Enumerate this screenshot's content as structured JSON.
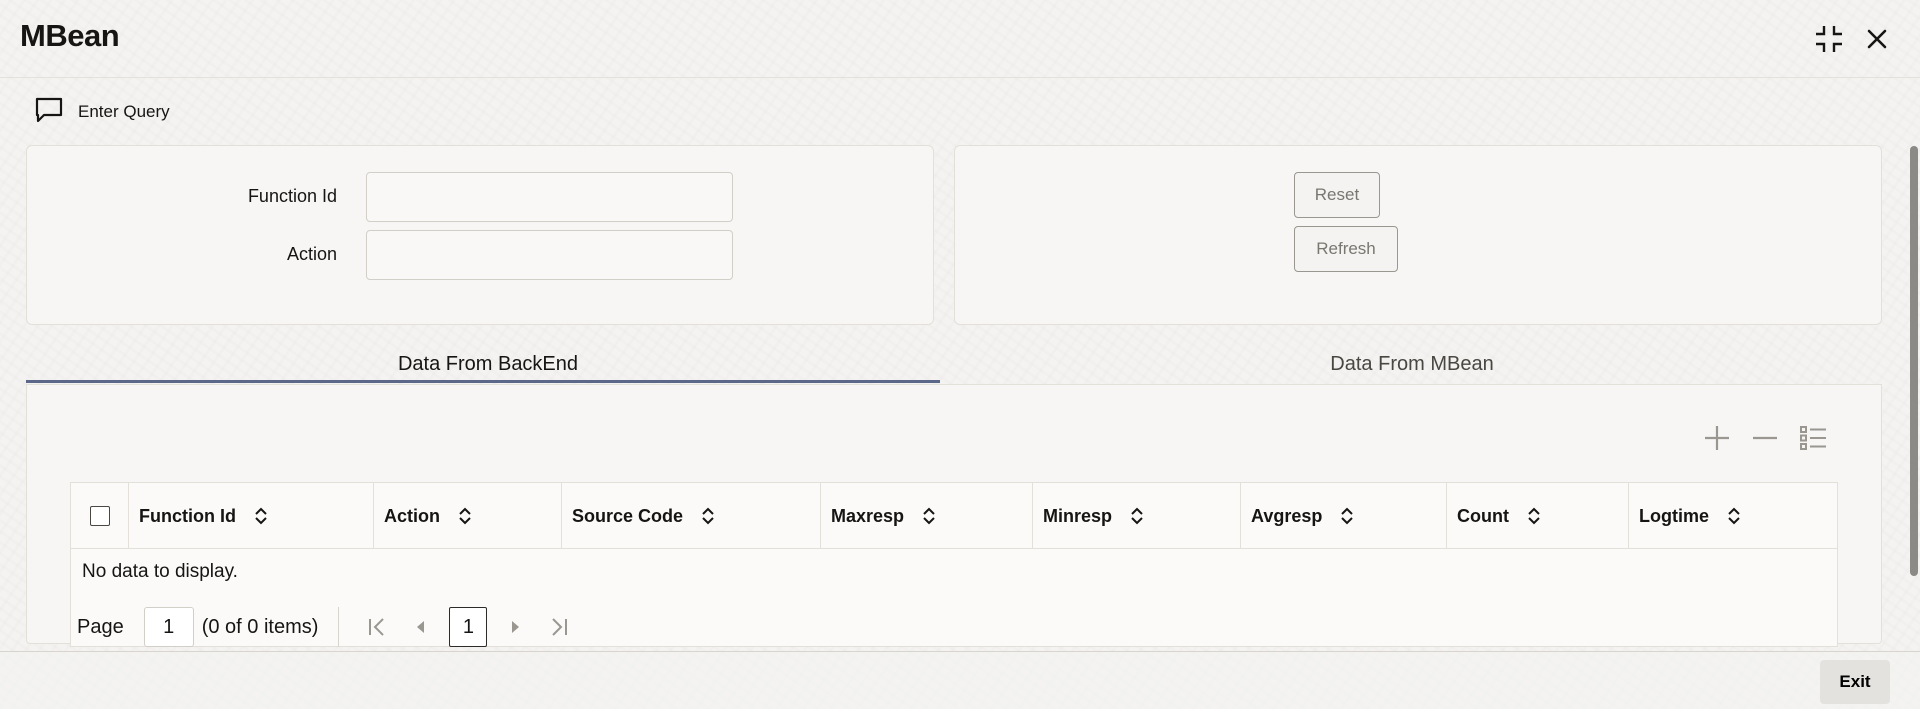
{
  "window": {
    "title": "MBean",
    "controls": {
      "collapse_icon": "collapse-icon",
      "close_icon": "close-icon"
    }
  },
  "toolbar": {
    "enter_query_label": "Enter Query",
    "enter_query_icon": "chat-bubble-icon"
  },
  "form": {
    "function_id_label": "Function Id",
    "function_id_value": "",
    "action_label": "Action",
    "action_value": ""
  },
  "buttons": {
    "reset_label": "Reset",
    "refresh_label": "Refresh"
  },
  "tabs": [
    {
      "label": "Data From BackEnd",
      "active": true
    },
    {
      "label": "Data From MBean",
      "active": false
    }
  ],
  "grid": {
    "tools": [
      "add-icon",
      "remove-icon",
      "list-view-icon"
    ],
    "columns": [
      "Function Id",
      "Action",
      "Source Code",
      "Maxresp",
      "Minresp",
      "Avgresp",
      "Count",
      "Logtime"
    ],
    "empty_message": "No data to display.",
    "pager": {
      "page_label": "Page",
      "page_value": "1",
      "items_summary": "(0 of 0 items)",
      "current_page": "1"
    }
  },
  "footer": {
    "exit_label": "Exit"
  },
  "colors": {
    "accent": "#5b6887",
    "background": "#f4f3f1",
    "text": "#161513"
  }
}
